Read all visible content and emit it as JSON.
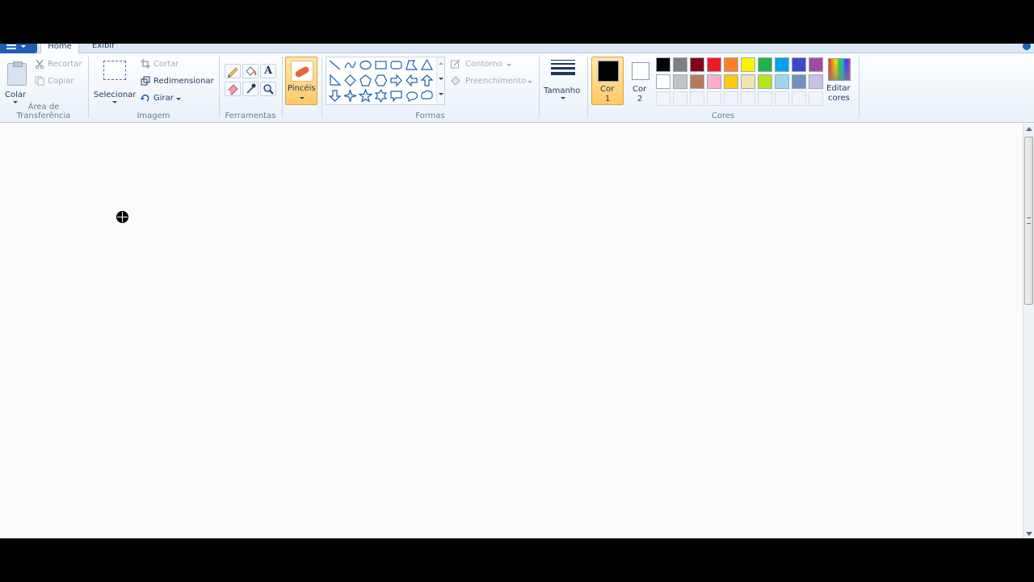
{
  "tabs": {
    "home": "Home",
    "view": "Exibir"
  },
  "clipboard": {
    "paste": "Colar",
    "cut": "Recortar",
    "copy": "Copiar",
    "group": "Área de Transferência"
  },
  "image": {
    "select": "Selecionar",
    "crop": "Cortar",
    "resize": "Redimensionar",
    "rotate": "Girar",
    "group": "Imagem"
  },
  "tools": {
    "group": "Ferramentas",
    "text_tool": "A"
  },
  "brushes": {
    "label": "Pincéis"
  },
  "shapes": {
    "outline": "Contorno",
    "fill": "Preenchimento",
    "group": "Formas"
  },
  "size": {
    "label": "Tamanho"
  },
  "colors": {
    "color1_line1": "Cor",
    "color1_line2": "1",
    "color2_line1": "Cor",
    "color2_line2": "2",
    "edit_line1": "Editar",
    "edit_line2": "cores",
    "group": "Cores",
    "color1_value": "#000000",
    "color2_value": "#ffffff",
    "palette_row1": [
      "#000000",
      "#7f7f7f",
      "#880015",
      "#ed1c24",
      "#ff7f27",
      "#fff200",
      "#22b14c",
      "#00a2e8",
      "#3f48cc",
      "#a349a4"
    ],
    "palette_row2": [
      "#ffffff",
      "#c3c3c3",
      "#b97a57",
      "#ffaec9",
      "#ffc90e",
      "#efe4b0",
      "#b5e61d",
      "#99d9ea",
      "#7092be",
      "#c8bfe7"
    ]
  }
}
